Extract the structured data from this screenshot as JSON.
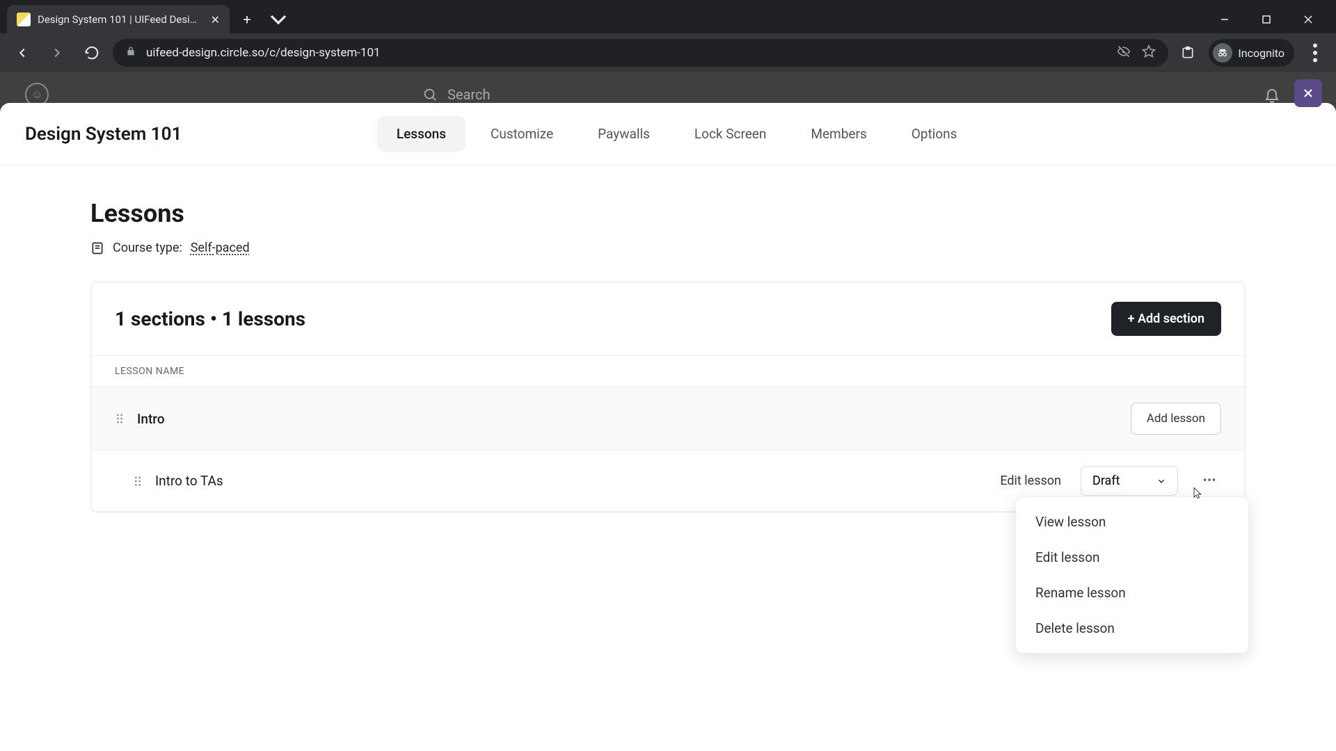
{
  "browser": {
    "tab_title": "Design System 101 | UIFeed Desi…",
    "url": "uifeed-design.circle.so/c/design-system-101",
    "incognito_label": "Incognito"
  },
  "appbar": {
    "search_placeholder": "Search"
  },
  "sheet": {
    "title": "Design System 101",
    "tabs": {
      "lessons": "Lessons",
      "customize": "Customize",
      "paywalls": "Paywalls",
      "lock_screen": "Lock Screen",
      "members": "Members",
      "options": "Options"
    }
  },
  "content": {
    "title": "Lessons",
    "course_type_label": "Course type:",
    "course_type_value": "Self-paced",
    "sections_count_text": "1 sections • 1 lessons",
    "add_section_btn": "+ Add section",
    "table_header": "LESSON NAME",
    "section_name": "Intro",
    "add_lesson_btn": "Add lesson",
    "lesson_name": "Intro to TAs",
    "edit_lesson": "Edit lesson",
    "status": "Draft"
  },
  "dropdown": {
    "view": "View lesson",
    "edit": "Edit lesson",
    "rename": "Rename lesson",
    "delete": "Delete lesson"
  }
}
